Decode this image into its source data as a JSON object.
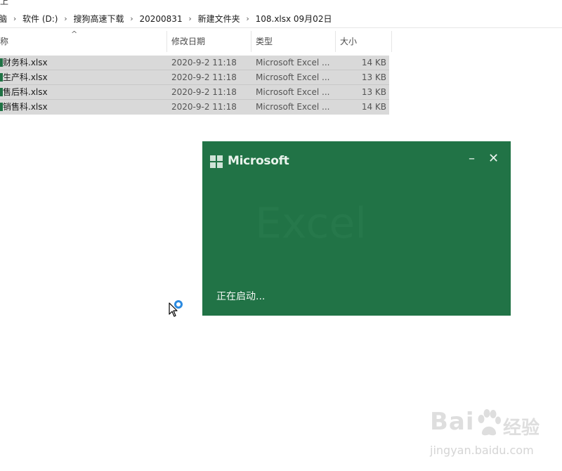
{
  "top_cut_text": "上",
  "breadcrumb": {
    "items": [
      "脑",
      "软件 (D:)",
      "搜狗高速下载",
      "20200831",
      "新建文件夹",
      "108.xlsx 09月02日"
    ],
    "separator": "›"
  },
  "columns": {
    "name": "称",
    "date": "修改日期",
    "type": "类型",
    "size": "大小",
    "sort_indicator": "^"
  },
  "files": [
    {
      "name": "财务科.xlsx",
      "date": "2020-9-2 11:18",
      "type": "Microsoft Excel ...",
      "size": "14 KB"
    },
    {
      "name": "生产科.xlsx",
      "date": "2020-9-2 11:18",
      "type": "Microsoft Excel ...",
      "size": "13 KB"
    },
    {
      "name": "售后科.xlsx",
      "date": "2020-9-2 11:18",
      "type": "Microsoft Excel ...",
      "size": "13 KB"
    },
    {
      "name": "销售科.xlsx",
      "date": "2020-9-2 11:18",
      "type": "Microsoft Excel ...",
      "size": "14 KB"
    }
  ],
  "splash": {
    "brand": "Microsoft",
    "app_name": "Excel",
    "status": "正在启动...",
    "minimize": "–",
    "close": "✕",
    "bg_color": "#217346"
  },
  "watermark": {
    "brand": "Bai",
    "brand2": "经验",
    "url": "jingyan.baidu.com"
  },
  "icons": {
    "cursor": "arrow-cursor-icon",
    "busy": "busy-spinner-icon",
    "file": "excel-file-icon",
    "logo": "microsoft-logo-icon"
  }
}
